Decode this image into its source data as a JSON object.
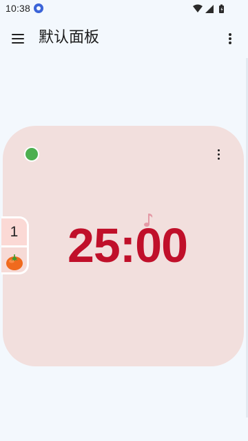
{
  "status_bar": {
    "time": "10:38",
    "icons": [
      "app-notification-icon",
      "wifi-icon",
      "signal-icon",
      "battery-icon"
    ]
  },
  "app_bar": {
    "title": "默认面板",
    "menu_icon": "hamburger-menu-icon",
    "overflow_icon": "more-vert-icon"
  },
  "timer_card": {
    "time": "25:00",
    "status_dot_color": "#4caf50",
    "menu_icon": "more-vert-icon",
    "background_color": "#f2dfdd",
    "time_color": "#c0102a"
  },
  "side_tab": {
    "count": "1",
    "icon": "tomato-icon"
  }
}
